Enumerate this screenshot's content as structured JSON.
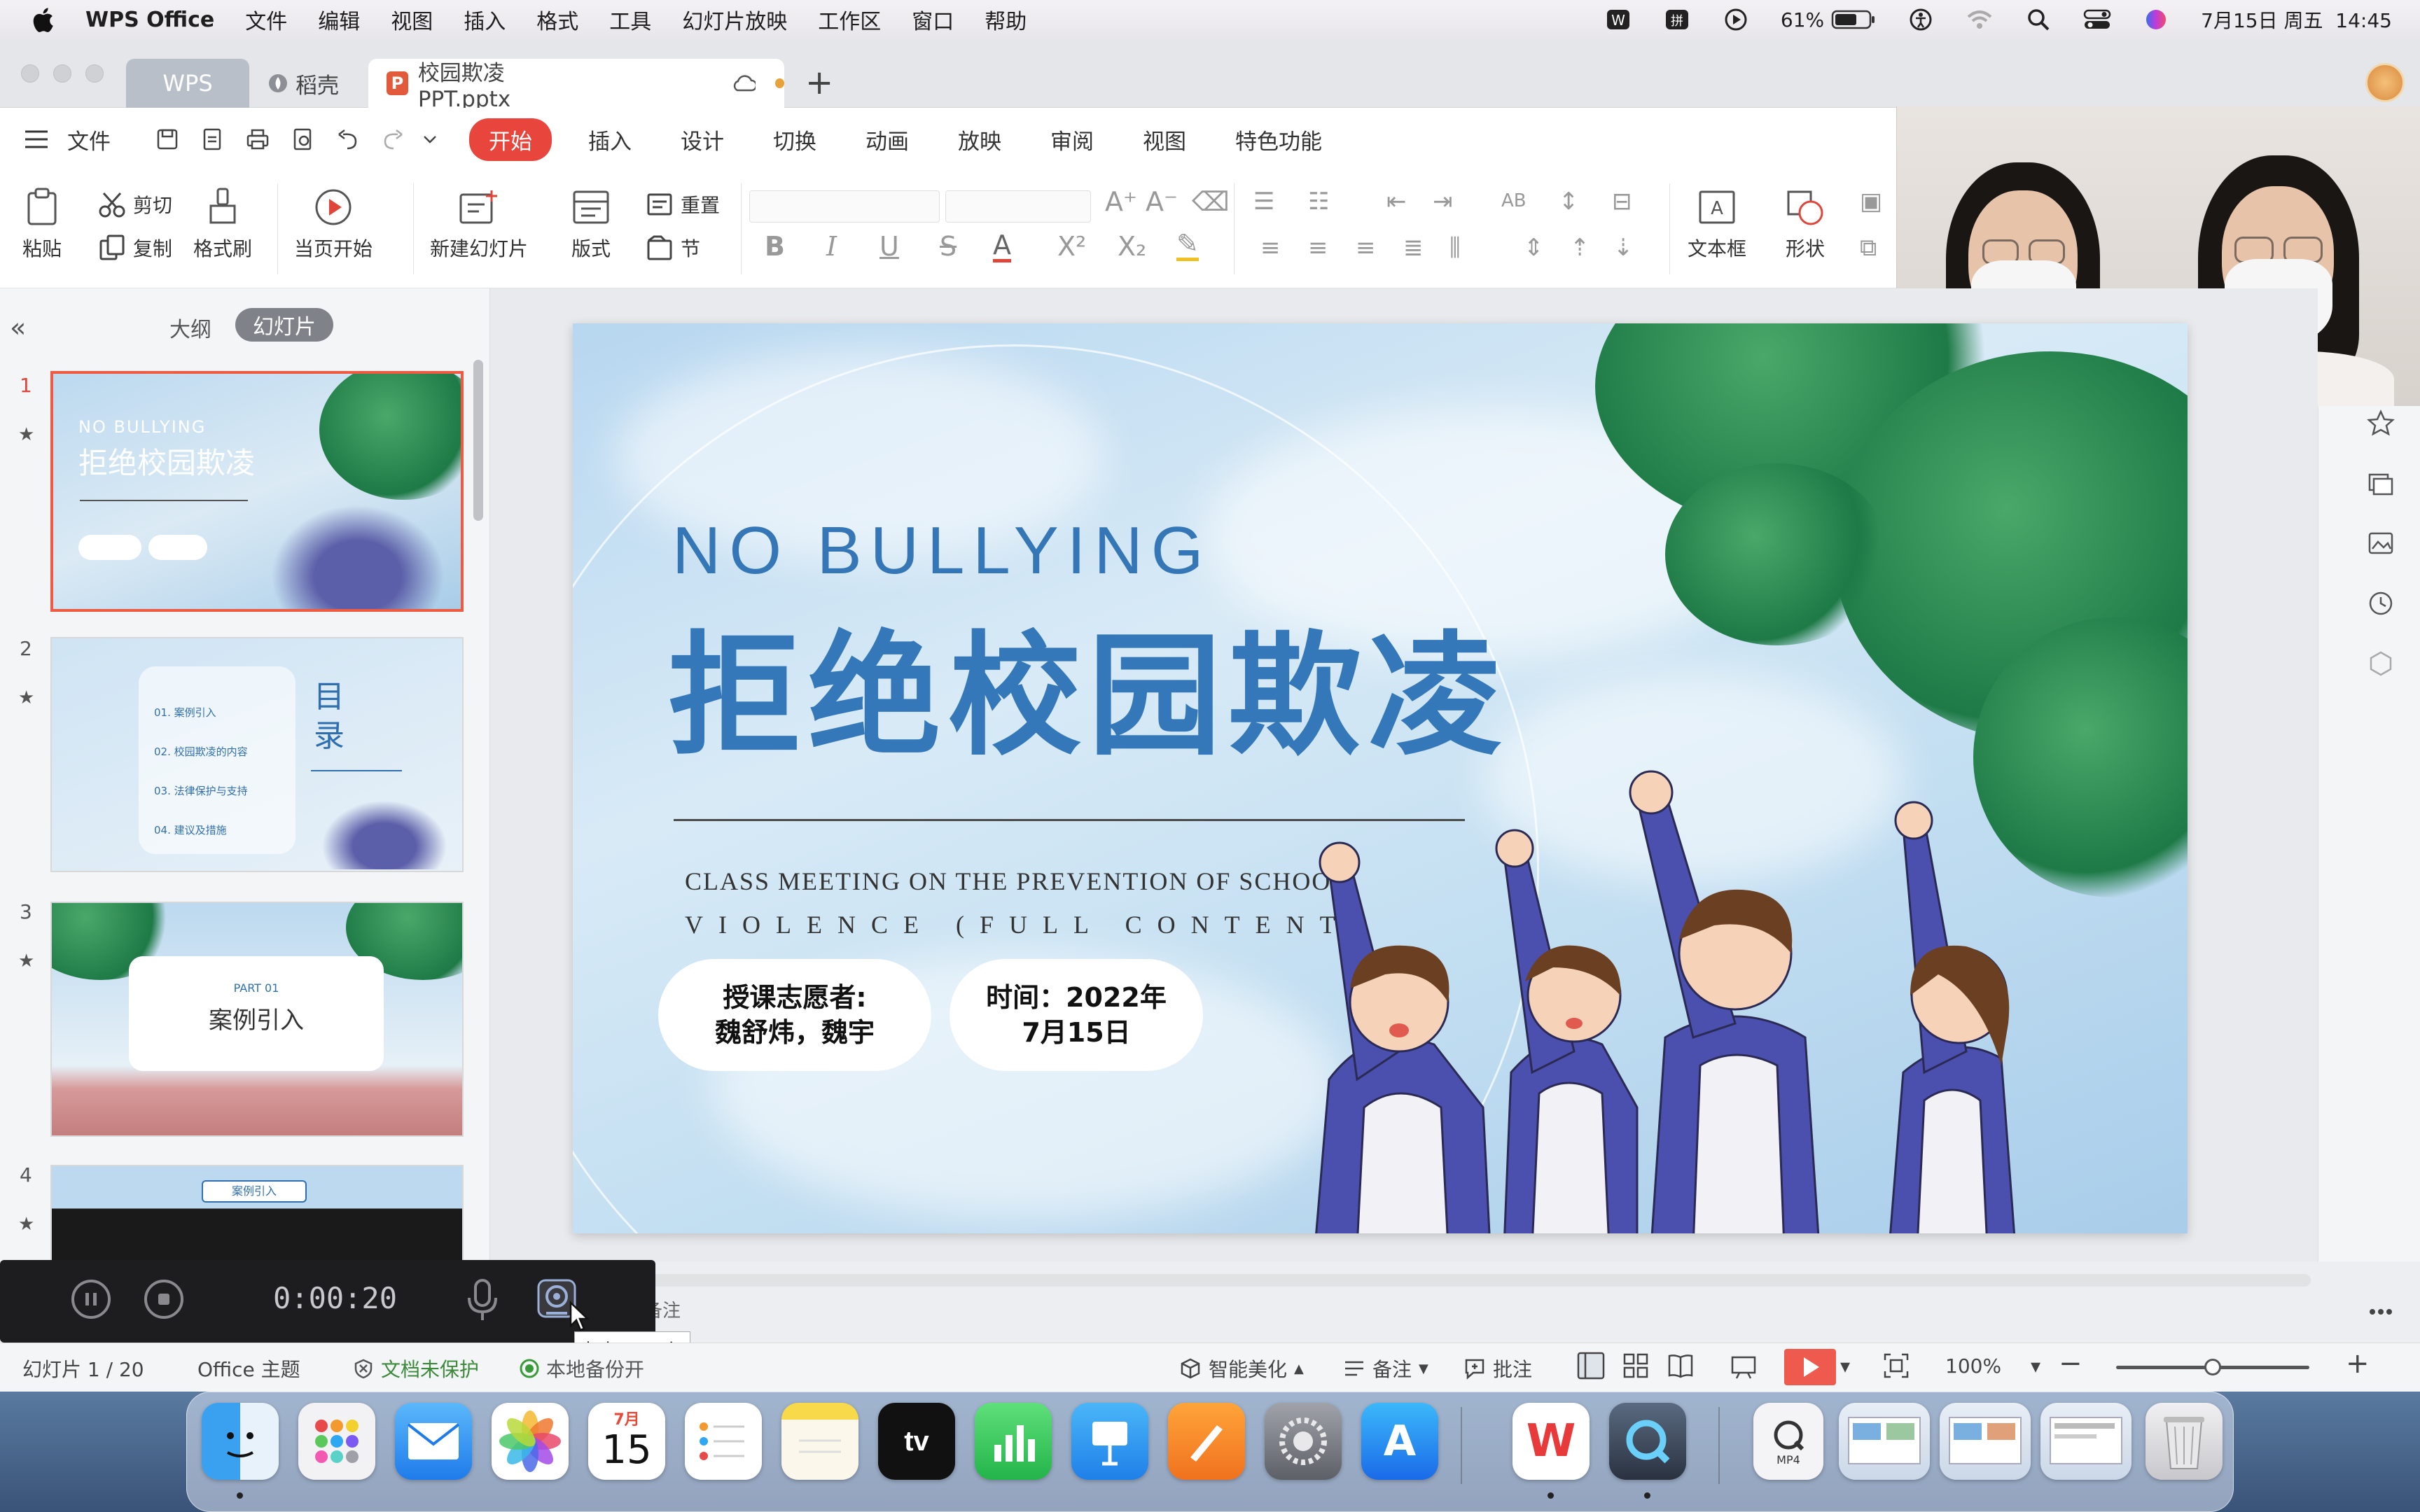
{
  "menubar": {
    "app_name": "WPS Office",
    "menus": [
      "文件",
      "编辑",
      "视图",
      "插入",
      "格式",
      "工具",
      "幻灯片放映",
      "工作区",
      "窗口",
      "帮助"
    ],
    "battery": "61%",
    "datetime": "7月15日 周五  14:45"
  },
  "tabs": {
    "wps": "WPS",
    "daoke": "稻壳",
    "doc": "校园欺凌PPT.pptx"
  },
  "ribbon_tabs": {
    "menu": "文件",
    "items": [
      "开始",
      "插入",
      "设计",
      "切换",
      "动画",
      "放映",
      "审阅",
      "视图",
      "特色功能"
    ]
  },
  "ribbon": {
    "paste": "粘贴",
    "cut": "剪切",
    "copy": "复制",
    "format_painter": "格式刷",
    "play_current": "当页开始",
    "new_slide": "新建幻灯片",
    "layout": "版式",
    "reset": "重置",
    "section": "节",
    "textbox": "文本框",
    "shape": "形状"
  },
  "left_panel": {
    "outline": "大纲",
    "slides": "幻灯片",
    "thumbs": [
      {
        "num": "1",
        "en": "NO BULLYING",
        "cn": "拒绝校园欺凌"
      },
      {
        "num": "2",
        "title": "目录",
        "items": [
          "01. 案例引入",
          "02. 校园欺凌的内容",
          "03. 法律保护与支持",
          "04. 建议及措施"
        ]
      },
      {
        "num": "3",
        "part": "PART 01",
        "title": "案例引入"
      },
      {
        "num": "4",
        "badge": "案例引入"
      }
    ]
  },
  "slide": {
    "title_en": "NO BULLYING",
    "title_cn": "拒绝校园欺凌",
    "subtitle_1": "CLASS MEETING ON THE PREVENTION OF SCHOOL",
    "subtitle_2": "VIOLENCE (FULL CONTENT)",
    "presenter_label": "授课志愿者:",
    "presenter_names": "魏舒炜，魏宇",
    "date_label": "时间：2022年",
    "date_value": "7月15日"
  },
  "recorder": {
    "time": "0:00:20",
    "tooltip": "相机已开启"
  },
  "notes_hint": "备注",
  "statusbar": {
    "slide_count": "幻灯片 1 / 20",
    "theme": "Office 主题",
    "protect": "文档未保护",
    "local": "本地备份开",
    "beautify": "智能美化",
    "notes": "备注",
    "comments": "批注",
    "zoom": "100%"
  },
  "dock": {
    "calendar_month": "7月",
    "calendar_day": "15",
    "mp4_label": "MP4"
  }
}
